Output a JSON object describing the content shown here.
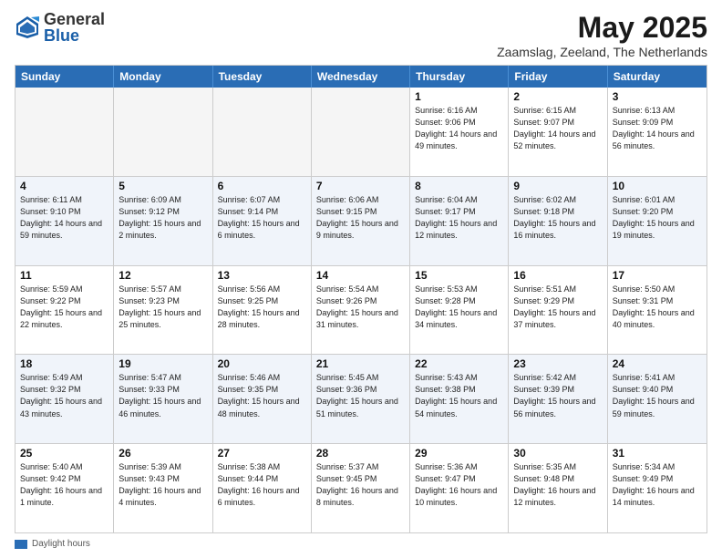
{
  "logo": {
    "general": "General",
    "blue": "Blue"
  },
  "title": "May 2025",
  "location": "Zaamslag, Zeeland, The Netherlands",
  "header_days": [
    "Sunday",
    "Monday",
    "Tuesday",
    "Wednesday",
    "Thursday",
    "Friday",
    "Saturday"
  ],
  "footer": {
    "label": "Daylight hours"
  },
  "weeks": [
    {
      "cells": [
        {
          "day": "",
          "info": ""
        },
        {
          "day": "",
          "info": ""
        },
        {
          "day": "",
          "info": ""
        },
        {
          "day": "",
          "info": ""
        },
        {
          "day": "1",
          "info": "Sunrise: 6:16 AM\nSunset: 9:06 PM\nDaylight: 14 hours\nand 49 minutes."
        },
        {
          "day": "2",
          "info": "Sunrise: 6:15 AM\nSunset: 9:07 PM\nDaylight: 14 hours\nand 52 minutes."
        },
        {
          "day": "3",
          "info": "Sunrise: 6:13 AM\nSunset: 9:09 PM\nDaylight: 14 hours\nand 56 minutes."
        }
      ]
    },
    {
      "cells": [
        {
          "day": "4",
          "info": "Sunrise: 6:11 AM\nSunset: 9:10 PM\nDaylight: 14 hours\nand 59 minutes."
        },
        {
          "day": "5",
          "info": "Sunrise: 6:09 AM\nSunset: 9:12 PM\nDaylight: 15 hours\nand 2 minutes."
        },
        {
          "day": "6",
          "info": "Sunrise: 6:07 AM\nSunset: 9:14 PM\nDaylight: 15 hours\nand 6 minutes."
        },
        {
          "day": "7",
          "info": "Sunrise: 6:06 AM\nSunset: 9:15 PM\nDaylight: 15 hours\nand 9 minutes."
        },
        {
          "day": "8",
          "info": "Sunrise: 6:04 AM\nSunset: 9:17 PM\nDaylight: 15 hours\nand 12 minutes."
        },
        {
          "day": "9",
          "info": "Sunrise: 6:02 AM\nSunset: 9:18 PM\nDaylight: 15 hours\nand 16 minutes."
        },
        {
          "day": "10",
          "info": "Sunrise: 6:01 AM\nSunset: 9:20 PM\nDaylight: 15 hours\nand 19 minutes."
        }
      ]
    },
    {
      "cells": [
        {
          "day": "11",
          "info": "Sunrise: 5:59 AM\nSunset: 9:22 PM\nDaylight: 15 hours\nand 22 minutes."
        },
        {
          "day": "12",
          "info": "Sunrise: 5:57 AM\nSunset: 9:23 PM\nDaylight: 15 hours\nand 25 minutes."
        },
        {
          "day": "13",
          "info": "Sunrise: 5:56 AM\nSunset: 9:25 PM\nDaylight: 15 hours\nand 28 minutes."
        },
        {
          "day": "14",
          "info": "Sunrise: 5:54 AM\nSunset: 9:26 PM\nDaylight: 15 hours\nand 31 minutes."
        },
        {
          "day": "15",
          "info": "Sunrise: 5:53 AM\nSunset: 9:28 PM\nDaylight: 15 hours\nand 34 minutes."
        },
        {
          "day": "16",
          "info": "Sunrise: 5:51 AM\nSunset: 9:29 PM\nDaylight: 15 hours\nand 37 minutes."
        },
        {
          "day": "17",
          "info": "Sunrise: 5:50 AM\nSunset: 9:31 PM\nDaylight: 15 hours\nand 40 minutes."
        }
      ]
    },
    {
      "cells": [
        {
          "day": "18",
          "info": "Sunrise: 5:49 AM\nSunset: 9:32 PM\nDaylight: 15 hours\nand 43 minutes."
        },
        {
          "day": "19",
          "info": "Sunrise: 5:47 AM\nSunset: 9:33 PM\nDaylight: 15 hours\nand 46 minutes."
        },
        {
          "day": "20",
          "info": "Sunrise: 5:46 AM\nSunset: 9:35 PM\nDaylight: 15 hours\nand 48 minutes."
        },
        {
          "day": "21",
          "info": "Sunrise: 5:45 AM\nSunset: 9:36 PM\nDaylight: 15 hours\nand 51 minutes."
        },
        {
          "day": "22",
          "info": "Sunrise: 5:43 AM\nSunset: 9:38 PM\nDaylight: 15 hours\nand 54 minutes."
        },
        {
          "day": "23",
          "info": "Sunrise: 5:42 AM\nSunset: 9:39 PM\nDaylight: 15 hours\nand 56 minutes."
        },
        {
          "day": "24",
          "info": "Sunrise: 5:41 AM\nSunset: 9:40 PM\nDaylight: 15 hours\nand 59 minutes."
        }
      ]
    },
    {
      "cells": [
        {
          "day": "25",
          "info": "Sunrise: 5:40 AM\nSunset: 9:42 PM\nDaylight: 16 hours\nand 1 minute."
        },
        {
          "day": "26",
          "info": "Sunrise: 5:39 AM\nSunset: 9:43 PM\nDaylight: 16 hours\nand 4 minutes."
        },
        {
          "day": "27",
          "info": "Sunrise: 5:38 AM\nSunset: 9:44 PM\nDaylight: 16 hours\nand 6 minutes."
        },
        {
          "day": "28",
          "info": "Sunrise: 5:37 AM\nSunset: 9:45 PM\nDaylight: 16 hours\nand 8 minutes."
        },
        {
          "day": "29",
          "info": "Sunrise: 5:36 AM\nSunset: 9:47 PM\nDaylight: 16 hours\nand 10 minutes."
        },
        {
          "day": "30",
          "info": "Sunrise: 5:35 AM\nSunset: 9:48 PM\nDaylight: 16 hours\nand 12 minutes."
        },
        {
          "day": "31",
          "info": "Sunrise: 5:34 AM\nSunset: 9:49 PM\nDaylight: 16 hours\nand 14 minutes."
        }
      ]
    }
  ]
}
